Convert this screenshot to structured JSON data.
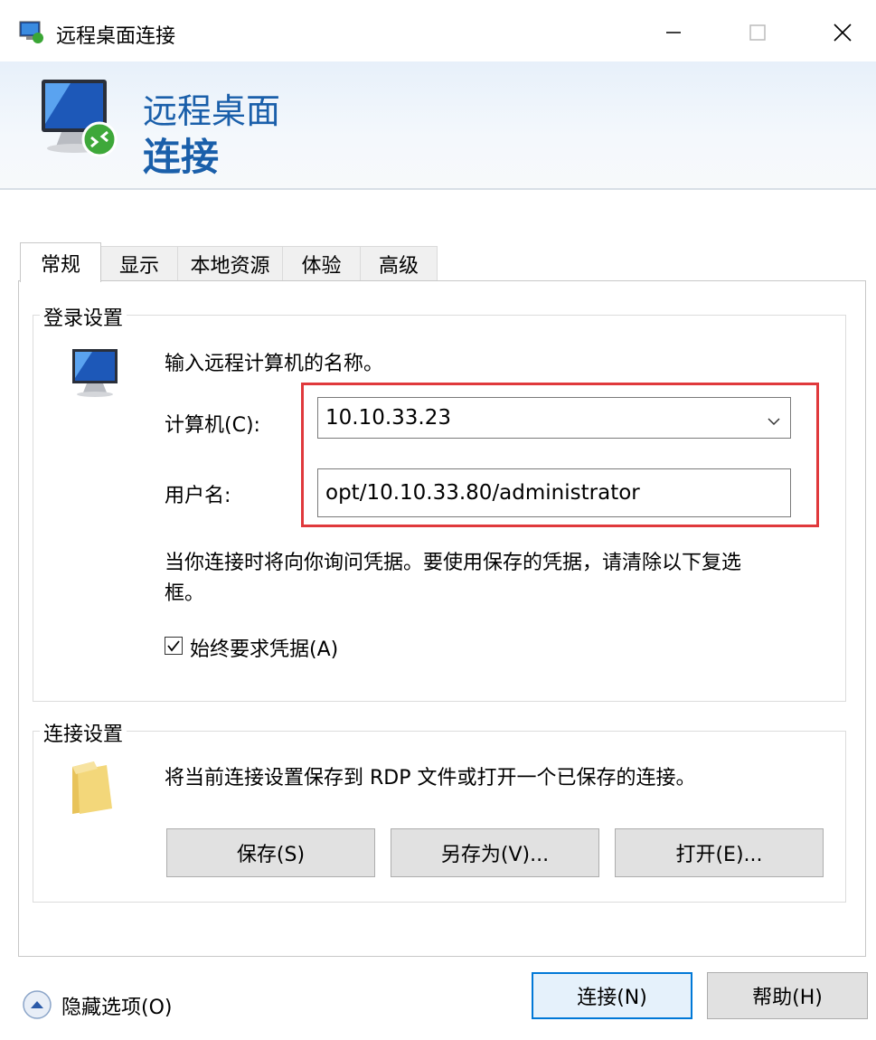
{
  "window": {
    "title": "远程桌面连接",
    "controls": [
      "minimize",
      "maximize",
      "close"
    ]
  },
  "banner": {
    "line1": "远程桌面",
    "line2": "连接"
  },
  "tabs": [
    {
      "label": "常规",
      "active": true
    },
    {
      "label": "显示",
      "active": false
    },
    {
      "label": "本地资源",
      "active": false
    },
    {
      "label": "体验",
      "active": false
    },
    {
      "label": "高级",
      "active": false
    }
  ],
  "login": {
    "legend": "登录设置",
    "description": "输入远程计算机的名称。",
    "computer_label": "计算机(C):",
    "computer_value": "10.10.33.23",
    "username_label": "用户名:",
    "username_value": "opt/10.10.33.80/administrator",
    "note_line1": "当你连接时将向你询问凭据。要使用保存的凭据，请清除以下复选",
    "note_line2": "框。",
    "checkbox_label": "始终要求凭据(A)",
    "checkbox_checked": true
  },
  "connection": {
    "legend": "连接设置",
    "description": "将当前连接设置保存到 RDP 文件或打开一个已保存的连接。",
    "save_label": "保存(S)",
    "save_as_label": "另存为(V)...",
    "open_label": "打开(E)..."
  },
  "footer": {
    "hide_options_label": "隐藏选项(O)",
    "connect_label": "连接(N)",
    "help_label": "帮助(H)"
  },
  "colors": {
    "banner_text": "#1a5faa",
    "highlight_border": "#e0393c",
    "default_button_border": "#0078d7"
  }
}
